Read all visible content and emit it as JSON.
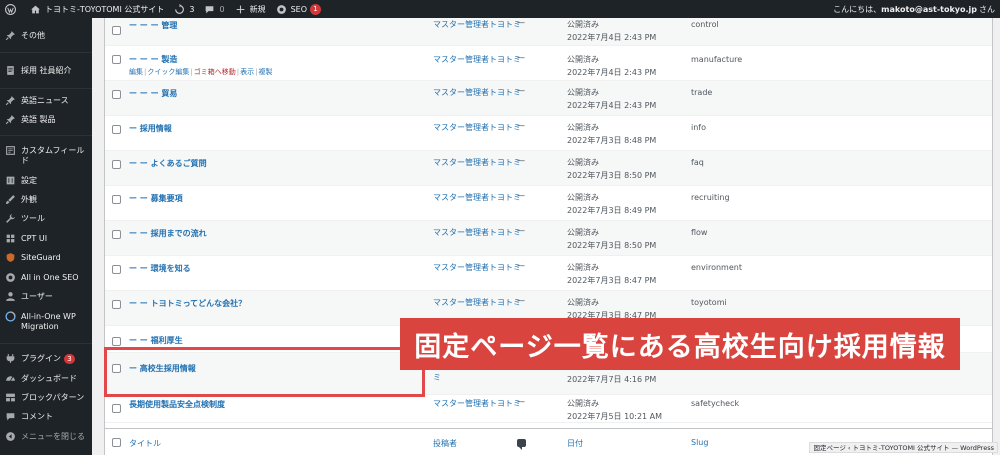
{
  "adminbar": {
    "site_name": "トヨトミ-TOYOTOMI 公式サイト",
    "updates_count": "3",
    "comments_count": "0",
    "new_label": "新規",
    "seo_label": "SEO",
    "seo_count": "1",
    "greeting": "こんにちは、",
    "user": "makoto@ast-tokyo.jp",
    "san": "さん"
  },
  "sidebar": {
    "items": [
      {
        "label": "その他",
        "icon": "thumbtack-icon"
      },
      {
        "label": "採用 社員紹介",
        "icon": "page-icon"
      },
      {
        "label": "英語ニュース",
        "icon": "thumbtack-icon"
      },
      {
        "label": "英語 製品",
        "icon": "thumbtack-icon"
      },
      {
        "label": "カスタムフィールド",
        "icon": "custom-fields-icon"
      },
      {
        "label": "設定",
        "icon": "settings-icon"
      },
      {
        "label": "外観",
        "icon": "brush-icon"
      },
      {
        "label": "ツール",
        "icon": "wrench-icon"
      },
      {
        "label": "CPT UI",
        "icon": "cptui-icon"
      },
      {
        "label": "SiteGuard",
        "icon": "siteguard-icon"
      },
      {
        "label": "All in One SEO",
        "icon": "aioseo-icon"
      },
      {
        "label": "ユーザー",
        "icon": "user-icon"
      },
      {
        "label": "All-in-One WP Migration",
        "icon": "migration-icon"
      },
      {
        "label": "プラグイン",
        "icon": "plugin-icon",
        "badge": "3"
      },
      {
        "label": "ダッシュボード",
        "icon": "dashboard-icon"
      },
      {
        "label": "ブロックパターン",
        "icon": "block-icon"
      },
      {
        "label": "コメント",
        "icon": "comment-icon"
      },
      {
        "label": "メニューを閉じる",
        "icon": "collapse-icon"
      }
    ]
  },
  "pages": {
    "row_actions": {
      "edit": "編集",
      "quick_edit": "クイック編集",
      "trash": "ゴミ箱へ移動",
      "view": "表示",
      "copy": "複製"
    },
    "rows": [
      {
        "title": "ー ー ー 管理",
        "author": "マスター管理者トヨトミ",
        "comments": "—",
        "status": "公開済み",
        "date": "2022年7月4日 2:43 PM",
        "slug": "control"
      },
      {
        "title": "ー ー ー 製造",
        "author": "マスター管理者トヨトミ",
        "comments": "—",
        "status": "公開済み",
        "date": "2022年7月4日 2:43 PM",
        "slug": "manufacture"
      },
      {
        "title": "ー ー ー 貿易",
        "author": "マスター管理者トヨトミ",
        "comments": "—",
        "status": "公開済み",
        "date": "2022年7月4日 2:43 PM",
        "slug": "trade"
      },
      {
        "title": "ー 採用情報",
        "author": "マスター管理者トヨトミ",
        "comments": "—",
        "status": "公開済み",
        "date": "2022年7月3日 8:48 PM",
        "slug": "info"
      },
      {
        "title": "ー ー よくあるご質問",
        "author": "マスター管理者トヨトミ",
        "comments": "—",
        "status": "公開済み",
        "date": "2022年7月3日 8:50 PM",
        "slug": "faq"
      },
      {
        "title": "ー ー 募集要項",
        "author": "マスター管理者トヨトミ",
        "comments": "—",
        "status": "公開済み",
        "date": "2022年7月3日 8:49 PM",
        "slug": "recruiting"
      },
      {
        "title": "ー ー 採用までの流れ",
        "author": "マスター管理者トヨトミ",
        "comments": "—",
        "status": "公開済み",
        "date": "2022年7月3日 8:50 PM",
        "slug": "flow"
      },
      {
        "title": "ー ー 環境を知る",
        "author": "マスター管理者トヨトミ",
        "comments": "—",
        "status": "公開済み",
        "date": "2022年7月3日 8:47 PM",
        "slug": "environment"
      },
      {
        "title": "ー ー トヨトミってどんな会社？",
        "author": "マスター管理者トヨトミ",
        "comments": "—",
        "status": "公開済み",
        "date": "2022年7月3日 8:47 PM",
        "slug": "toyotomi"
      },
      {
        "title": "ー ー 福利厚生",
        "author": "",
        "comments": "",
        "status": "",
        "date": "",
        "slug": ""
      },
      {
        "title": "ー 高校生採用情報",
        "author": "ミ",
        "comments": "",
        "status": "",
        "date": "2022年7月7日 4:16 PM",
        "slug": ""
      },
      {
        "title": "長期使用製品安全点検制度",
        "author": "マスター管理者トヨトミ",
        "comments": "—",
        "status": "公開済み",
        "date": "2022年7月5日 10:21 AM",
        "slug": "safetycheck"
      }
    ],
    "footer": {
      "title": "タイトル",
      "author": "投稿者",
      "date": "日付",
      "slug": "Slug"
    }
  },
  "callout": "固定ページ一覧にある高校生向け採用情報",
  "status_tip": "固定ページ ‹ トヨトミ-TOYOTOMI 公式サイト — WordPress"
}
